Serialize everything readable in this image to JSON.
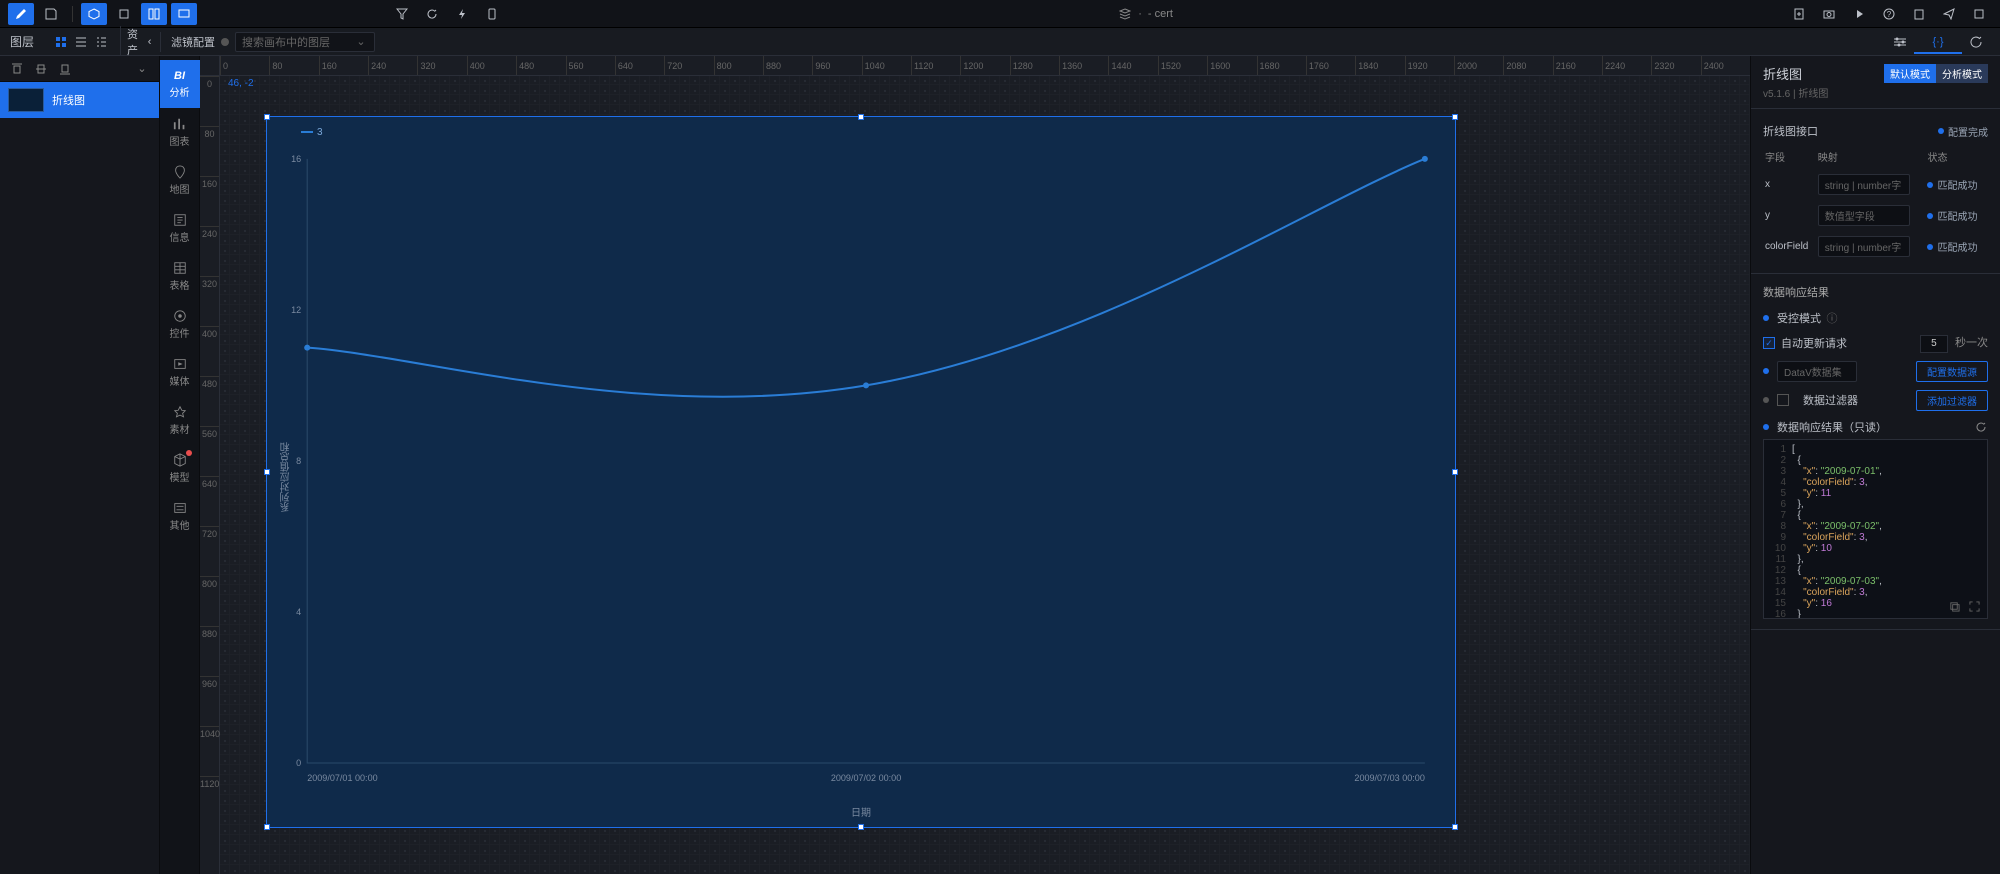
{
  "topbar": {
    "title_prefix": "·",
    "title": "- cert"
  },
  "left_panel": {
    "title": "图层",
    "layer_name": "折线图"
  },
  "toolbar2": {
    "assets_label": "资产",
    "filter_label": "滤镜配置",
    "search_placeholder": "搜索画布中的图层"
  },
  "asset_cats": [
    {
      "key": "bi",
      "label": "BI\n分析",
      "bi": true
    },
    {
      "key": "chart",
      "label": "图表"
    },
    {
      "key": "map",
      "label": "地图"
    },
    {
      "key": "info",
      "label": "信息"
    },
    {
      "key": "table",
      "label": "表格"
    },
    {
      "key": "control",
      "label": "控件"
    },
    {
      "key": "media",
      "label": "媒体"
    },
    {
      "key": "material",
      "label": "素材"
    },
    {
      "key": "model",
      "label": "模型",
      "badge": true
    },
    {
      "key": "other",
      "label": "其他"
    }
  ],
  "ruler_h": [
    0,
    80,
    160,
    240,
    320,
    400,
    480,
    560,
    640,
    720,
    800,
    880,
    960,
    1040,
    1120,
    1200,
    1280,
    1360,
    1440,
    1520,
    1600,
    1680,
    1760,
    1840,
    1920,
    2000,
    2080,
    2160,
    2240,
    2320,
    2400
  ],
  "ruler_v": [
    0,
    80,
    160,
    240,
    320,
    400,
    480,
    560,
    640,
    720,
    800,
    880,
    960,
    1040,
    1120
  ],
  "coord": "46, -2",
  "chart_data": {
    "type": "line",
    "title": "",
    "xlabel": "日期",
    "ylabel": "系列对应值总和",
    "x": [
      "2009/07/01 00:00",
      "2009/07/02 00:00",
      "2009/07/03 00:00"
    ],
    "series": [
      {
        "name": "3",
        "values": [
          11,
          10,
          16
        ],
        "color": "#2a7dd6"
      }
    ],
    "y_ticks": [
      0,
      4,
      8,
      12,
      16
    ],
    "ylim": [
      0,
      16
    ]
  },
  "config": {
    "title": "折线图",
    "sub": "v5.1.6 | 折线图",
    "mode_default": "默认模式",
    "mode_analysis": "分析模式",
    "api_title": "折线图接口",
    "api_status": "配置完成",
    "col_field": "字段",
    "col_map": "映射",
    "col_status": "状态",
    "row_x": "x",
    "row_y": "y",
    "row_color": "colorField",
    "ph_number": "string | number字",
    "ph_numtype": "数值型字段",
    "status_ok": "匹配成功",
    "resp_title": "数据响应结果",
    "controlled": "受控模式",
    "auto_refresh": "自动更新请求",
    "auto_refresh_val": "5",
    "auto_refresh_unit": "秒一次",
    "datasource": "DataV数据集",
    "datasource_btn": "配置数据源",
    "filter": "数据过滤器",
    "filter_btn": "添加过滤器",
    "result_ro": "数据响应结果（只读）"
  },
  "code_lines": [
    "[",
    "  {",
    "    \"x\": \"2009-07-01\",",
    "    \"colorField\": 3,",
    "    \"y\": 11",
    "  },",
    "  {",
    "    \"x\": \"2009-07-02\",",
    "    \"colorField\": 3,",
    "    \"y\": 10",
    "  },",
    "  {",
    "    \"x\": \"2009-07-03\",",
    "    \"colorField\": 3,",
    "    \"y\": 16",
    "  }"
  ]
}
